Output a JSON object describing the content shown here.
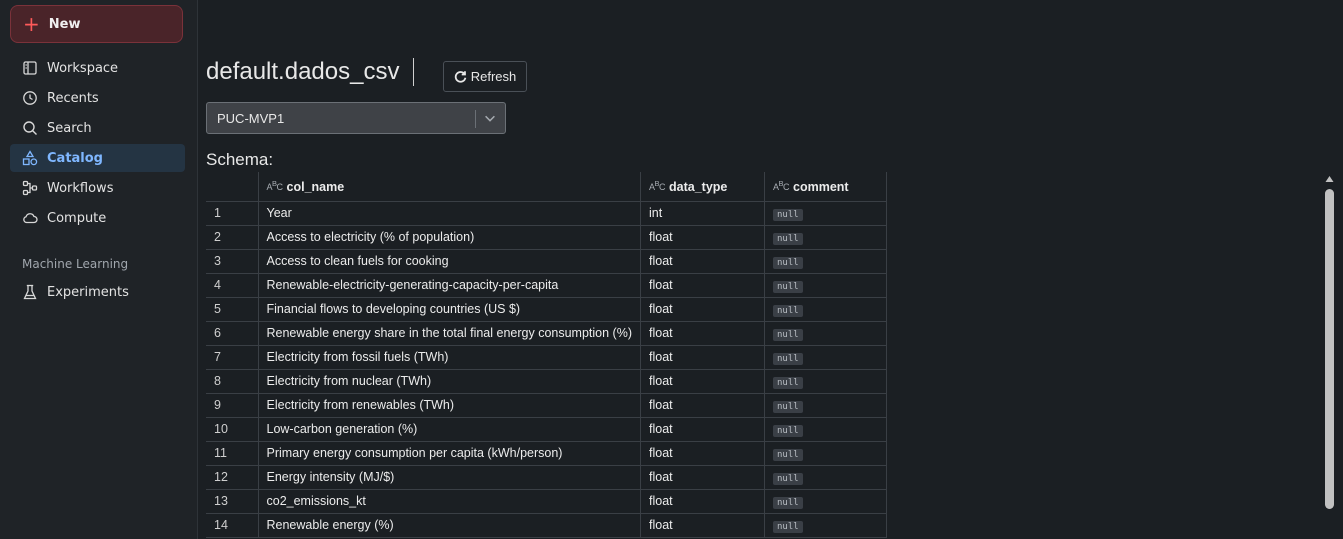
{
  "sidebar": {
    "new_label": "New",
    "items": [
      {
        "label": "Workspace",
        "icon": "workspace-icon",
        "active": false
      },
      {
        "label": "Recents",
        "icon": "clock-icon",
        "active": false
      },
      {
        "label": "Search",
        "icon": "search-icon",
        "active": false
      },
      {
        "label": "Catalog",
        "icon": "catalog-icon",
        "active": true
      },
      {
        "label": "Workflows",
        "icon": "workflows-icon",
        "active": false
      },
      {
        "label": "Compute",
        "icon": "cloud-icon",
        "active": false
      }
    ],
    "section_ml": "Machine Learning",
    "ml_items": [
      {
        "label": "Experiments",
        "icon": "flask-icon"
      }
    ]
  },
  "main": {
    "title": "default.dados_csv",
    "refresh_label": "Refresh",
    "selected_cluster": "PUC-MVP1",
    "schema_label": "Schema:",
    "columns": [
      "col_name",
      "data_type",
      "comment"
    ],
    "rows": [
      {
        "idx": "1",
        "col_name": "Year",
        "data_type": "int",
        "comment": "null"
      },
      {
        "idx": "2",
        "col_name": "Access to electricity (% of population)",
        "data_type": "float",
        "comment": "null"
      },
      {
        "idx": "3",
        "col_name": "Access to clean fuels for cooking",
        "data_type": "float",
        "comment": "null"
      },
      {
        "idx": "4",
        "col_name": "Renewable-electricity-generating-capacity-per-capita",
        "data_type": "float",
        "comment": "null"
      },
      {
        "idx": "5",
        "col_name": "Financial flows to developing countries (US $)",
        "data_type": "float",
        "comment": "null"
      },
      {
        "idx": "6",
        "col_name": "Renewable energy share in the total final energy consumption (%)",
        "data_type": "float",
        "comment": "null"
      },
      {
        "idx": "7",
        "col_name": "Electricity from fossil fuels (TWh)",
        "data_type": "float",
        "comment": "null"
      },
      {
        "idx": "8",
        "col_name": "Electricity from nuclear (TWh)",
        "data_type": "float",
        "comment": "null"
      },
      {
        "idx": "9",
        "col_name": "Electricity from renewables (TWh)",
        "data_type": "float",
        "comment": "null"
      },
      {
        "idx": "10",
        "col_name": "Low-carbon generation (%)",
        "data_type": "float",
        "comment": "null"
      },
      {
        "idx": "11",
        "col_name": "Primary energy consumption per capita (kWh/person)",
        "data_type": "float",
        "comment": "null"
      },
      {
        "idx": "12",
        "col_name": "Energy intensity (MJ/$)",
        "data_type": "float",
        "comment": "null"
      },
      {
        "idx": "13",
        "col_name": "co2_emissions_kt",
        "data_type": "float",
        "comment": "null"
      },
      {
        "idx": "14",
        "col_name": "Renewable energy (%)",
        "data_type": "float",
        "comment": "null"
      }
    ]
  },
  "colors": {
    "background": "#1b1f23",
    "accent": "#7fb7ff",
    "new_button_bg": "#4a2429",
    "plus": "#ff5a5a"
  }
}
